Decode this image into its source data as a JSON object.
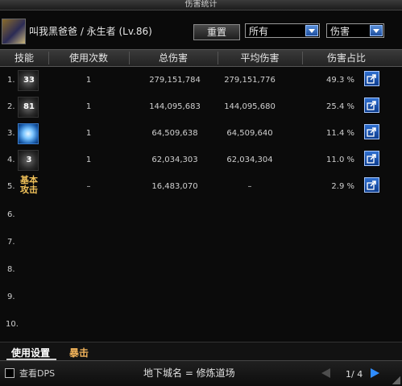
{
  "window": {
    "title": "伤害统计"
  },
  "header": {
    "player_name": "叫我黑爸爸 / 永生者 (Lv.86)",
    "reset_label": "重置",
    "filter_left": "所有",
    "filter_right": "伤害"
  },
  "table": {
    "columns": [
      "技能",
      "使用次数",
      "总伤害",
      "平均伤害",
      "伤害占比"
    ],
    "rows": [
      {
        "rank": "1.",
        "skill_level": "33",
        "count": "1",
        "total": "279,151,784",
        "avg": "279,151,776",
        "pct": "49.3 %"
      },
      {
        "rank": "2.",
        "skill_level": "81",
        "count": "1",
        "total": "144,095,683",
        "avg": "144,095,680",
        "pct": "25.4 %"
      },
      {
        "rank": "3.",
        "skill_level": "",
        "count": "1",
        "total": "64,509,638",
        "avg": "64,509,640",
        "pct": "11.4 %"
      },
      {
        "rank": "4.",
        "skill_level": "3",
        "count": "1",
        "total": "62,034,303",
        "avg": "62,034,304",
        "pct": "11.0 %"
      },
      {
        "rank": "5.",
        "skill_level": "基本攻击",
        "count": "–",
        "total": "16,483,070",
        "avg": "–",
        "pct": "2.9 %"
      },
      {
        "rank": "6."
      },
      {
        "rank": "7."
      },
      {
        "rank": "8."
      },
      {
        "rank": "9."
      },
      {
        "rank": "10."
      }
    ]
  },
  "tabs": {
    "usage": "使用设置",
    "crit": "暴击"
  },
  "footer": {
    "show_dps": "查看DPS",
    "dungeon": "地下城名 = 修炼道场",
    "page": "1/ 4"
  }
}
